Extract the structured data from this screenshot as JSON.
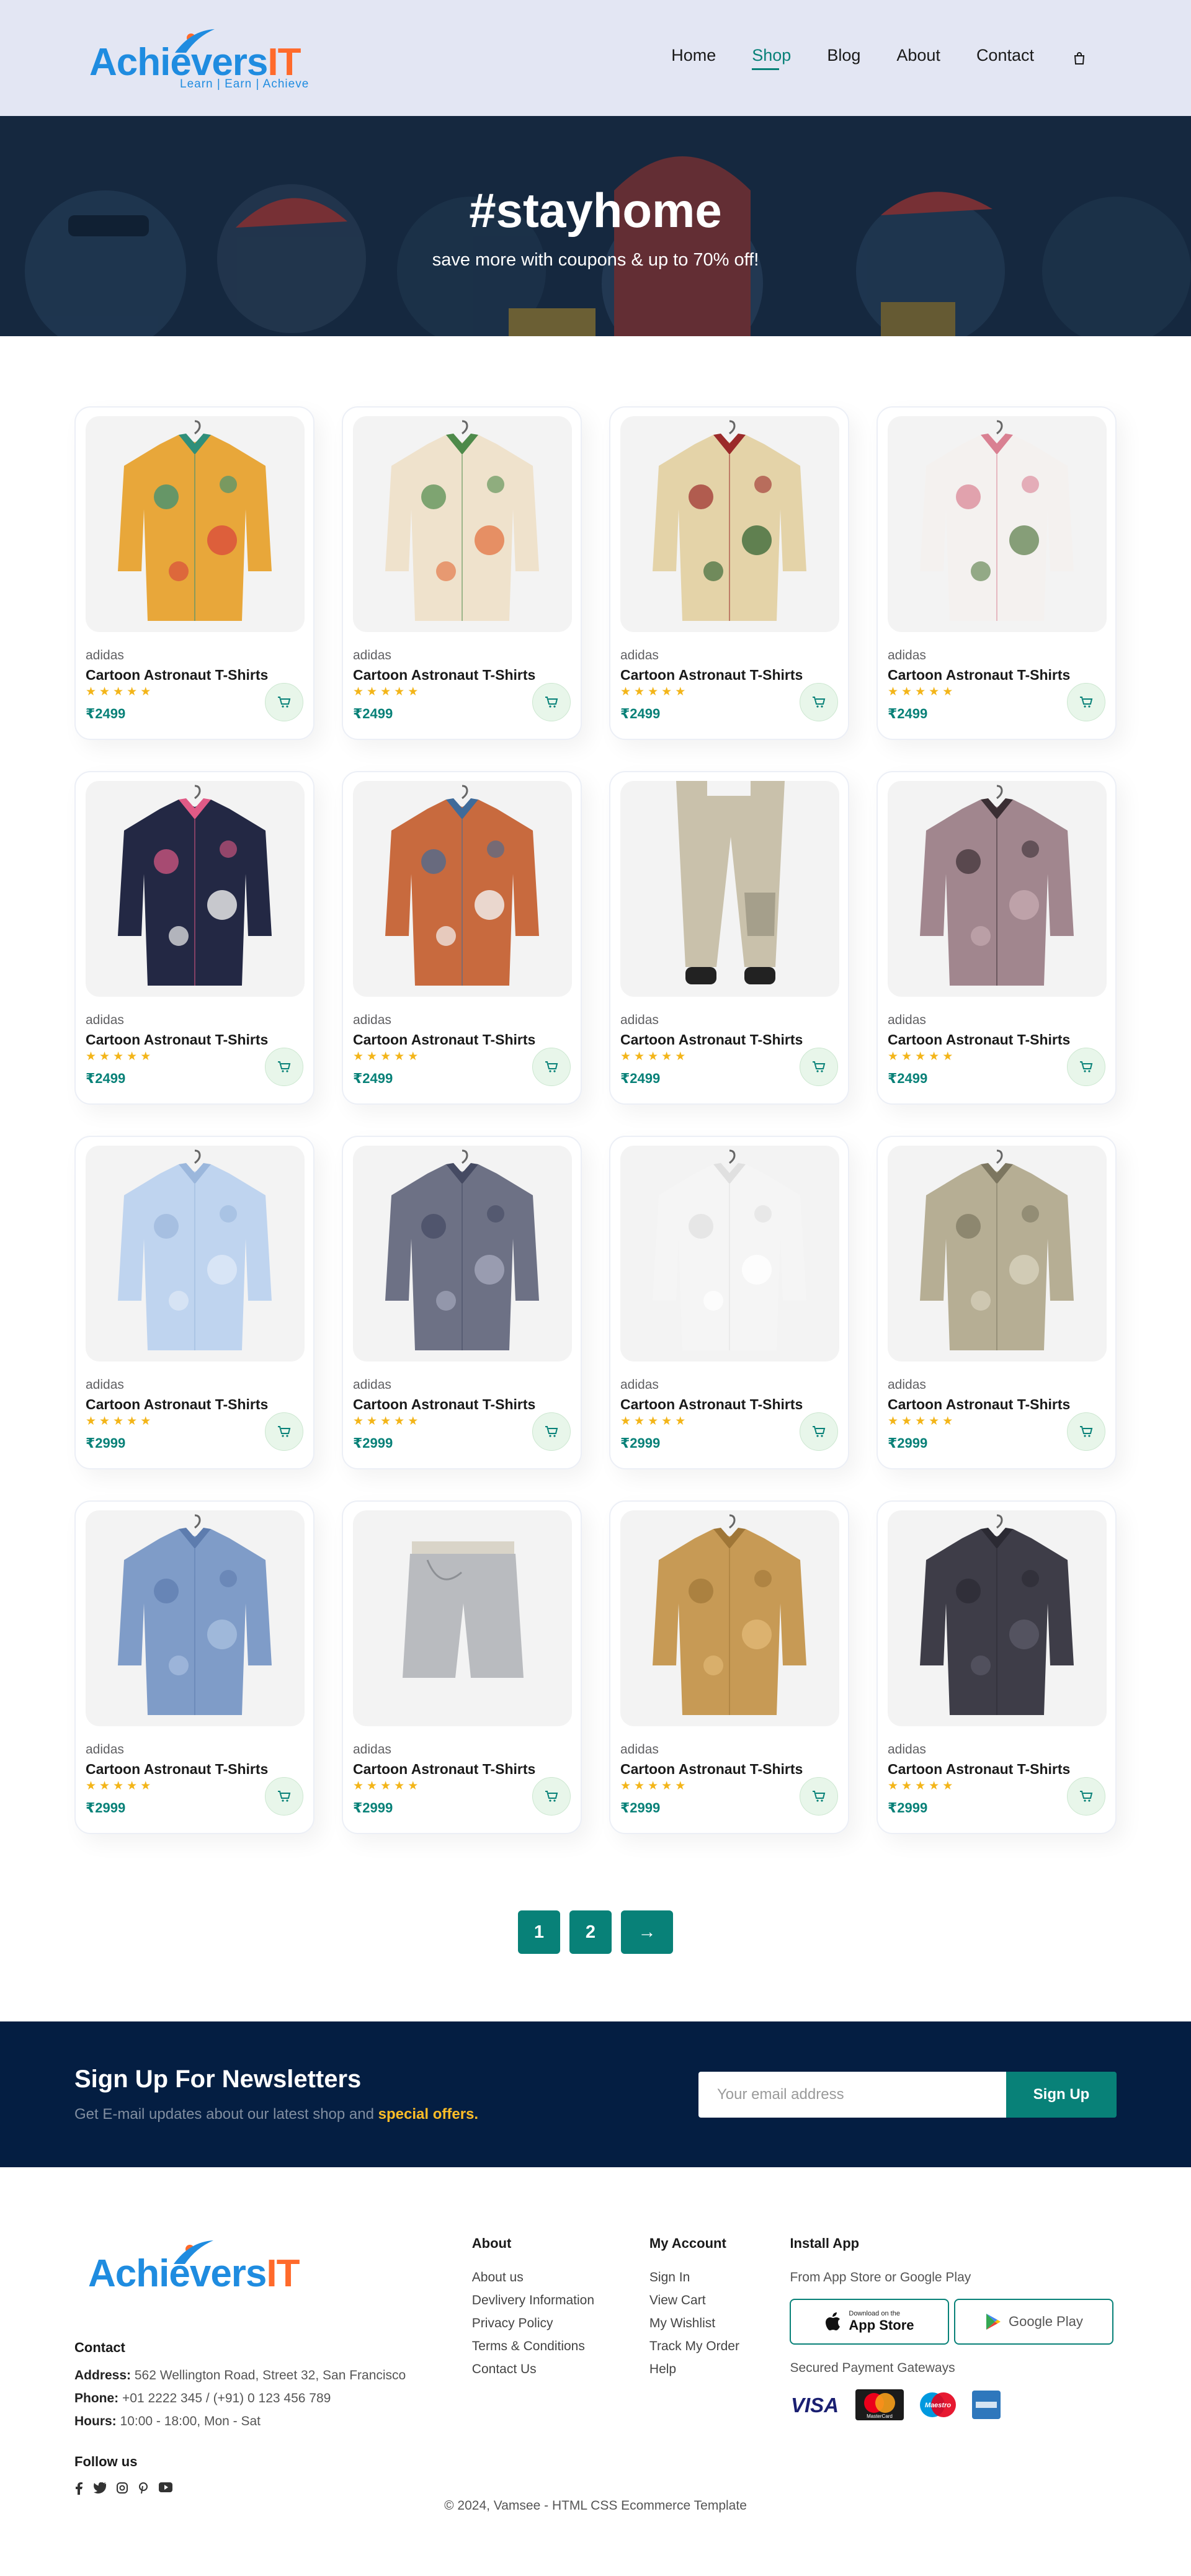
{
  "header": {
    "logo_text_a": "Achie",
    "logo_text_b": "vers",
    "logo_text_c": "IT",
    "logo_tagline": "Learn | Earn | Achieve",
    "nav": [
      "Home",
      "Shop",
      "Blog",
      "About",
      "Contact"
    ],
    "active_nav": "Shop"
  },
  "hero": {
    "title": "#stayhome",
    "subtitle": "save more with coupons & up to 70% off!"
  },
  "products": [
    {
      "brand": "adidas",
      "title": "Cartoon Astronaut T-Shirts",
      "price": "₹2499",
      "rating": 5,
      "image": "shirt-tropical-yellow"
    },
    {
      "brand": "adidas",
      "title": "Cartoon Astronaut T-Shirts",
      "price": "₹2499",
      "rating": 5,
      "image": "shirt-leaf-beige"
    },
    {
      "brand": "adidas",
      "title": "Cartoon Astronaut T-Shirts",
      "price": "₹2499",
      "rating": 5,
      "image": "shirt-floral-red"
    },
    {
      "brand": "adidas",
      "title": "Cartoon Astronaut T-Shirts",
      "price": "₹2499",
      "rating": 5,
      "image": "shirt-floral-white"
    },
    {
      "brand": "adidas",
      "title": "Cartoon Astronaut T-Shirts",
      "price": "₹2499",
      "rating": 5,
      "image": "shirt-navy-floral"
    },
    {
      "brand": "adidas",
      "title": "Cartoon Astronaut T-Shirts",
      "price": "₹2499",
      "rating": 5,
      "image": "shirt-orange-denim"
    },
    {
      "brand": "adidas",
      "title": "Cartoon Astronaut T-Shirts",
      "price": "₹2499",
      "rating": 5,
      "image": "trousers-beige"
    },
    {
      "brand": "adidas",
      "title": "Cartoon Astronaut T-Shirts",
      "price": "₹2499",
      "rating": 5,
      "image": "top-mauve-print"
    },
    {
      "brand": "adidas",
      "title": "Cartoon Astronaut T-Shirts",
      "price": "₹2999",
      "rating": 5,
      "image": "shirt-light-blue"
    },
    {
      "brand": "adidas",
      "title": "Cartoon Astronaut T-Shirts",
      "price": "₹2999",
      "rating": 5,
      "image": "shirt-striped-navy"
    },
    {
      "brand": "adidas",
      "title": "Cartoon Astronaut T-Shirts",
      "price": "₹2999",
      "rating": 5,
      "image": "shirt-white"
    },
    {
      "brand": "adidas",
      "title": "Cartoon Astronaut T-Shirts",
      "price": "₹2999",
      "rating": 5,
      "image": "shirt-olive-print"
    },
    {
      "brand": "adidas",
      "title": "Cartoon Astronaut T-Shirts",
      "price": "₹2999",
      "rating": 5,
      "image": "shirt-denim-blue"
    },
    {
      "brand": "adidas",
      "title": "Cartoon Astronaut T-Shirts",
      "price": "₹2999",
      "rating": 5,
      "image": "shorts-grey"
    },
    {
      "brand": "adidas",
      "title": "Cartoon Astronaut T-Shirts",
      "price": "₹2999",
      "rating": 5,
      "image": "shirt-tan"
    },
    {
      "brand": "adidas",
      "title": "Cartoon Astronaut T-Shirts",
      "price": "₹2999",
      "rating": 5,
      "image": "shirt-charcoal"
    }
  ],
  "pagination": {
    "pages": [
      "1",
      "2"
    ],
    "next": "→"
  },
  "newsletter": {
    "title": "Sign Up For Newsletters",
    "text": "Get E-mail updates about our latest shop and",
    "highlight": "special offers.",
    "placeholder": "Your email address",
    "button": "Sign Up"
  },
  "footer": {
    "contact_title": "Contact",
    "address_label": "Address:",
    "address": "562 Wellington Road, Street 32, San Francisco",
    "phone_label": "Phone:",
    "phone": "+01 2222 345 / (+91) 0 123 456 789",
    "hours_label": "Hours:",
    "hours": "10:00 - 18:00, Mon - Sat",
    "follow_title": "Follow us",
    "about_title": "About",
    "about_links": [
      "About us",
      "Devlivery Information",
      "Privacy Policy",
      "Terms & Conditions",
      "Contact Us"
    ],
    "account_title": "My Account",
    "account_links": [
      "Sign In",
      "View Cart",
      "My Wishlist",
      "Track My Order",
      "Help"
    ],
    "install_title": "Install App",
    "install_text": "From App Store or Google Play",
    "appstore_small": "Download on the",
    "appstore_big": "App Store",
    "googleplay": "Google Play",
    "gateways_text": "Secured Payment Gateways",
    "visa": "VISA",
    "mastercard": "MasterCard",
    "maestro": "Maestro",
    "copyright": "© 2024, Vamsee - HTML CSS Ecommerce Template"
  },
  "colors": {
    "accent": "#088178",
    "header_bg": "#e3e6f3",
    "newsletter_bg": "#041e42",
    "star": "#f3b519",
    "highlight": "#ffbd27"
  }
}
